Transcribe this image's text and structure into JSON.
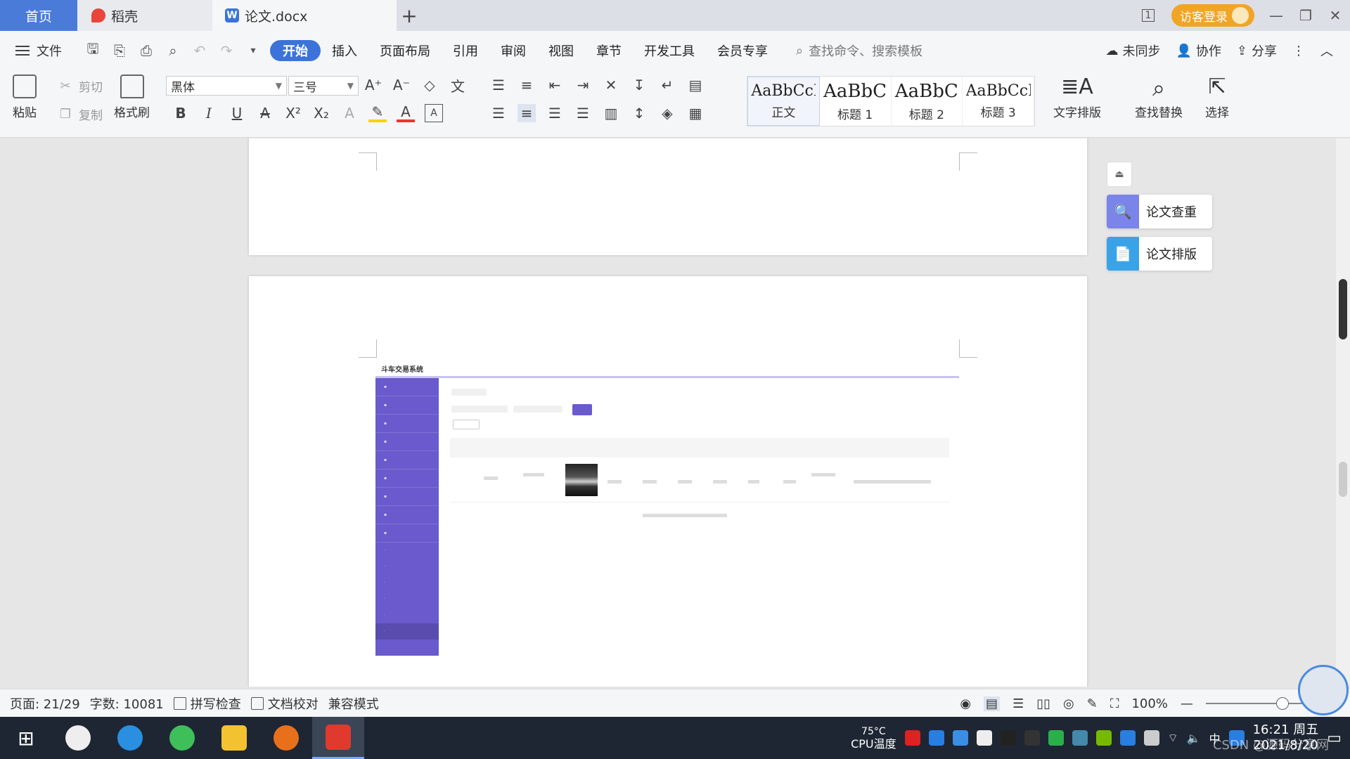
{
  "titlebar": {
    "tabs": [
      {
        "label": "首页"
      },
      {
        "label": "稻壳"
      },
      {
        "label": "论文.docx"
      }
    ],
    "add_tab": "+",
    "layout_btn": "1",
    "visitor_login": "访客登录",
    "minimize": "—",
    "restore": "❐",
    "close": "✕"
  },
  "menubar": {
    "file": "文件",
    "tabs": [
      "开始",
      "插入",
      "页面布局",
      "引用",
      "审阅",
      "视图",
      "章节",
      "开发工具",
      "会员专享"
    ],
    "search_placeholder": "查找命令、搜索模板",
    "unsynced": "未同步",
    "collaborate": "协作",
    "share": "分享"
  },
  "ribbon": {
    "paste": "粘贴",
    "cut": "剪切",
    "copy": "复制",
    "format_painter": "格式刷",
    "font_name": "黑体",
    "font_size": "三号",
    "styles": [
      {
        "sample": "AaBbCcDd",
        "name": "正文"
      },
      {
        "sample": "AaBbC",
        "name": "标题 1"
      },
      {
        "sample": "AaBbC",
        "name": "标题 2"
      },
      {
        "sample": "AaBbCcI",
        "name": "标题 3"
      }
    ],
    "text_layout": "文字排版",
    "find_replace": "查找替换",
    "select": "选择"
  },
  "side_panel": {
    "paper_check": "论文查重",
    "paper_layout": "论文排版"
  },
  "embedded_screenshot": {
    "title": "斗车交易系统"
  },
  "statusbar": {
    "page": "页面: 21/29",
    "words": "字数: 10081",
    "spell_check": "拼写检查",
    "doc_proof": "文档校对",
    "compat_mode": "兼容模式",
    "zoom": "100%",
    "zoom_minus": "—",
    "zoom_plus": "+"
  },
  "taskbar": {
    "cpu_temp": "75°C",
    "cpu_label": "CPU温度",
    "ime": "中",
    "time": "16:21 周五",
    "date": "2021/8/20"
  },
  "watermark": "CSDN @源码分享网",
  "colors": {
    "accent": "#3b73d9",
    "login": "#f0a526",
    "sidebar_purple": "#6a5acd"
  }
}
